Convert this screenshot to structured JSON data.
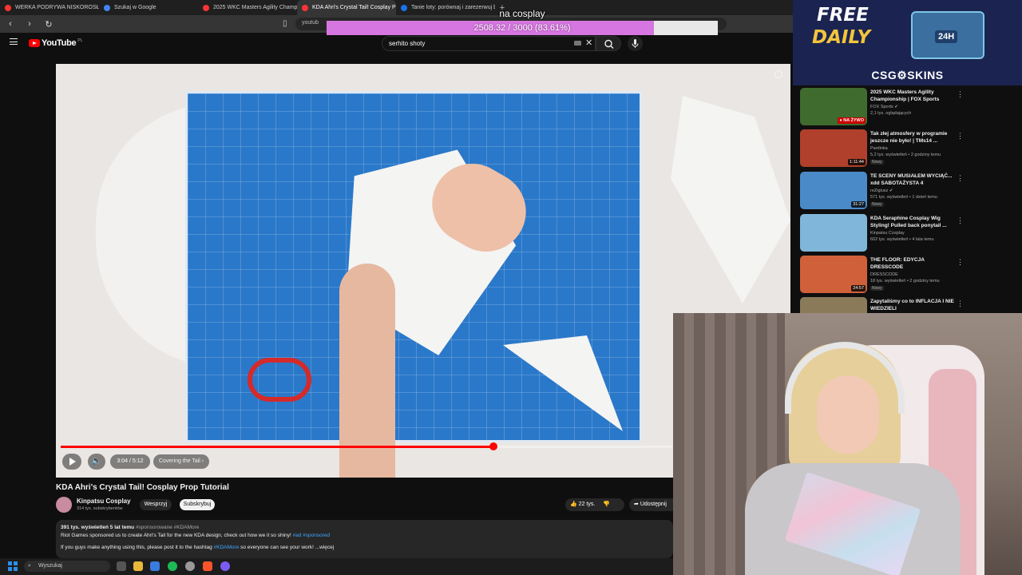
{
  "browser": {
    "tabs": [
      {
        "label": "WERKA PODRYWA NISKOROSŁYCH",
        "color": "#ff3333",
        "active": false
      },
      {
        "label": "Szukaj w Google",
        "color": "#4285f4",
        "active": false
      },
      {
        "label": "2025 WKC Masters Agility Champion",
        "color": "#ff3333",
        "active": false
      },
      {
        "label": "KDA Ahri's Crystal Tail! Cosplay P",
        "color": "#ff3333",
        "active": true
      },
      {
        "label": "Tanie loty: porównaj i zarezerwuj bile",
        "color": "#1a73e8",
        "active": false
      }
    ],
    "new_tab": "+",
    "url": "youtub"
  },
  "overlay": {
    "goal_label": "na cosplay",
    "goal_text": "2508.32 / 3000 (83.61%)",
    "goal_fraction": 0.8361,
    "fill_color": "#d676e0"
  },
  "youtube": {
    "logo": "YouTube",
    "country": "PL",
    "search_value": "serhito shoty"
  },
  "player": {
    "time": "3:04 / 5:12",
    "chapter": "Covering the Tail ›",
    "played_fraction": 0.707,
    "progress_color": "#ff0000"
  },
  "video": {
    "title": "KDA Ahri's Crystal Tail! Cosplay Prop Tutorial",
    "channel": "Kinpatsu Cosplay",
    "subscribers": "314 tys. subskrybentów",
    "support_label": "Wesprzyj",
    "subscribe_label": "Subskrybuj",
    "likes": "22 tys.",
    "share_label": "Udostępnij",
    "description": {
      "meta": "391 tys. wyświetleń  5 lat temu",
      "tags": "#sponsorowane #KDAMore",
      "line1": "Riot Games sponsored us to create Ahri's Tail for the new KDA design, check out how we it so shiny! ",
      "line1_links": "#ad #sponsored",
      "line2_pre": "If you guys make anything using this, please post it to the hashtag ",
      "line2_link": "#KDAMore",
      "line2_post": " so everyone can see your work!",
      "more": " ...więcej"
    }
  },
  "ad": {
    "free": "FREE",
    "daily": "DAILY",
    "chest": "24H",
    "brand": "CSG⚙SKINS"
  },
  "recommendations": [
    {
      "title": "2025 WKC Masters Agility Championship | FOX Sports",
      "channel": "FOX Sports ✔",
      "meta": "2,1 tys. oglądających",
      "badge": "",
      "overlay": "● NA ŻYWO",
      "live": true,
      "thumb": "#3f6b2f"
    },
    {
      "title": "Tak złej atmosfery w programie jeszcze nie było! | TMs14 ...",
      "channel": "Pardinka",
      "meta": "5,2 tys. wyświetleń • 2 godziny temu",
      "badge": "Nowy",
      "overlay": "1:11:44",
      "live": false,
      "thumb": "#b0402c"
    },
    {
      "title": "TE SCENY MUSIAŁEM WYCIĄĆ... xdd SABOTAŻYSTA 4",
      "channel": "reZigiusz ✔",
      "meta": "571 tys. wyświetleń • 1 dzień temu",
      "badge": "Nowy",
      "overlay": "31:27",
      "live": false,
      "thumb": "#4a8ac9"
    },
    {
      "title": "KDA Seraphine Cosplay Wig Styling! Pulled back ponytail ...",
      "channel": "Kinpatsu Cosplay",
      "meta": "602 tys. wyświetleń • 4 lata temu",
      "badge": "",
      "overlay": "",
      "live": false,
      "thumb": "#7fb6d9"
    },
    {
      "title": "THE FLOOR: EDYCJA DRESSCODE",
      "channel": "DRESSCODE",
      "meta": "18 tys. wyświetleń • 2 godziny temu",
      "badge": "Nowy",
      "overlay": "24:57",
      "live": false,
      "thumb": "#d0603a"
    },
    {
      "title": "Zapytaliśmy co to INFLACJA I NIE WIEDZIELI",
      "channel": "",
      "meta": "",
      "badge": "",
      "overlay": "",
      "live": false,
      "thumb": "#8a7a5a"
    }
  ],
  "taskbar": {
    "search": "Wyszukaj"
  }
}
